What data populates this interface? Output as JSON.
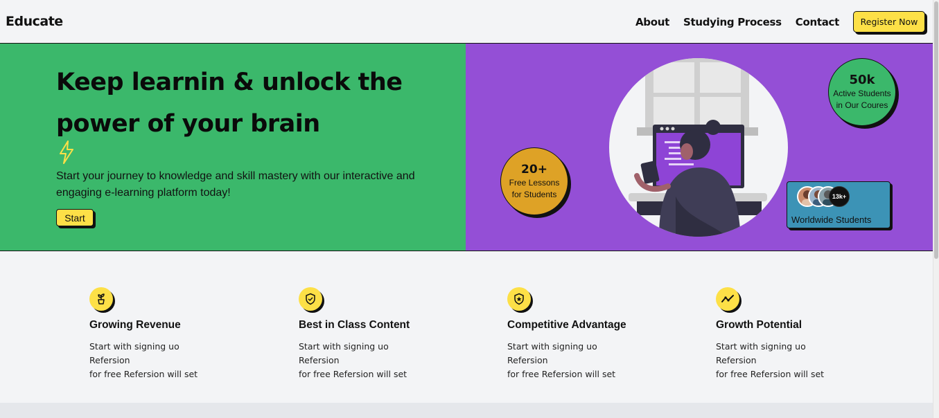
{
  "header": {
    "logo": "Educate",
    "nav": [
      "About",
      "Studying Process",
      "Contact"
    ],
    "register_label": "Register Now"
  },
  "hero": {
    "title": "Keep learnin & unlock the power of your brain",
    "subtitle": "Start your journey to knowledge and skill mastery with our interactive and engaging e-learning platform today!",
    "start_label": "Start",
    "colors": {
      "left": "#3bb86b",
      "right": "#944fd6",
      "accent": "#fde047"
    },
    "lessons_badge": {
      "number": "20+",
      "line1": "Free Lessons",
      "line2": "for Students"
    },
    "active_badge": {
      "number": "50k",
      "line1": "Active Students",
      "line2": "in Our Coures"
    },
    "worldwide": {
      "count": "13k+",
      "label": "Worldwide Students"
    }
  },
  "features": [
    {
      "icon": "plant-icon",
      "title": "Growing Revenue",
      "line1": "Start with signing uo Refersion",
      "line2": "for free Refersion will set"
    },
    {
      "icon": "shield-check-icon",
      "title": "Best in Class Content",
      "line1": "Start with signing uo Refersion",
      "line2": "for free Refersion will set"
    },
    {
      "icon": "shield-star-icon",
      "title": "Competitive Advantage",
      "line1": "Start with signing uo Refersion",
      "line2": "for free Refersion will set"
    },
    {
      "icon": "trend-line-icon",
      "title": "Growth Potential",
      "line1": "Start with signing uo Refersion",
      "line2": "for free Refersion will set"
    }
  ]
}
